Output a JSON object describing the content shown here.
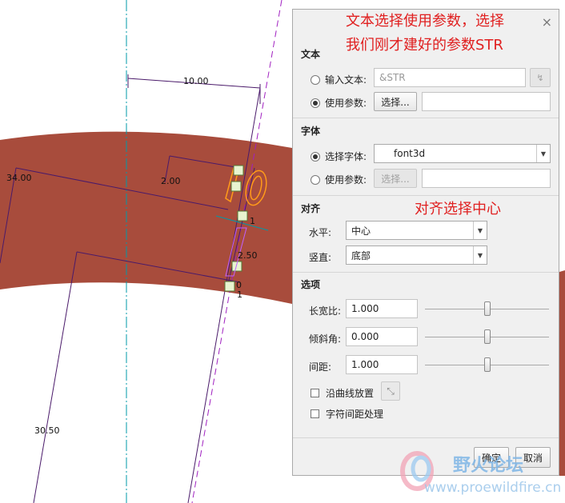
{
  "viewport": {
    "dims": {
      "d1": "10.00",
      "d2": "34.00",
      "d3": "2.00",
      "d4": "2.50",
      "d5": "30.50",
      "d6": "0",
      "d7": "1",
      "d8": "1"
    },
    "colors": {
      "part": "#a84c3c",
      "centerline": "#009aa8",
      "dimline": "#4a1a6a",
      "axis": "#a020c0",
      "text3d": "#ff9a1a"
    }
  },
  "dialog": {
    "close_glyph": "×",
    "text_section": {
      "title": "文本",
      "input_text_label": "输入文本:",
      "input_text_value": "&STR",
      "use_param_label": "使用参数:",
      "select_button": "选择...",
      "param_value": ""
    },
    "font_section": {
      "title": "字体",
      "select_font_label": "选择字体:",
      "font_value": "font3d",
      "use_param_label": "使用参数:",
      "select_button": "选择...",
      "param_value": ""
    },
    "align_section": {
      "title": "对齐",
      "horizontal_label": "水平:",
      "horizontal_value": "中心",
      "vertical_label": "竖直:",
      "vertical_value": "底部"
    },
    "options_section": {
      "title": "选项",
      "aspect_label": "长宽比:",
      "aspect_value": "1.000",
      "aspect_slider": 0.5,
      "slant_label": "倾斜角:",
      "slant_value": "0.000",
      "slant_slider": 0.5,
      "spacing_label": "间距:",
      "spacing_value": "1.000",
      "spacing_slider": 0.5,
      "curve_label": "沿曲线放置",
      "kerning_label": "字符间距处理"
    },
    "ok_button": "确定",
    "cancel_button": "取消"
  },
  "annotations": {
    "note1_line1": "文本选择使用参数，选择",
    "note1_line2": "我们刚才建好的参数STR",
    "note2": "对齐选择中心"
  },
  "watermark": {
    "brand": "野火论坛",
    "url": "www.proewildfire.cn"
  }
}
